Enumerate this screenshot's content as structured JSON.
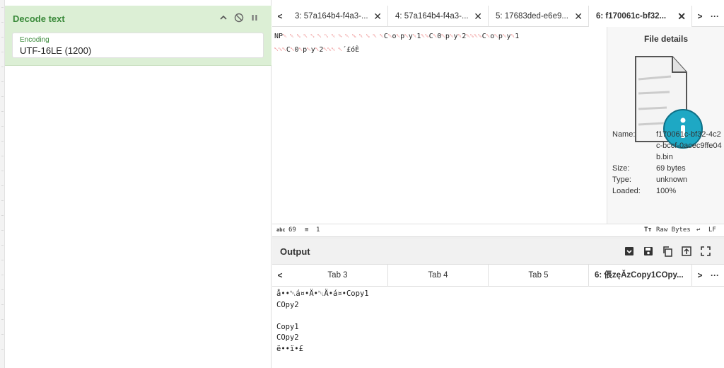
{
  "recipe": {
    "operation_title": "Decode text",
    "encoding_label": "Encoding",
    "encoding_value": "UTF-16LE (1200)"
  },
  "input": {
    "tabs": [
      {
        "label": "3: 57a164b4-f4a3-..."
      },
      {
        "label": "4: 57a164b4-f4a3-..."
      },
      {
        "label": "5: 17683ded-e6e9..."
      },
      {
        "label": "6: f170061c-bf32..."
      }
    ],
    "prev": "<",
    "next": ">",
    "more": "···",
    "line1_start": "NP",
    "line1_tail": "",
    "line2_end": "´£óÈ"
  },
  "file_details": {
    "title": "File details",
    "name_label": "Name:",
    "name_value": "f170061c-bf32-4c2c-bccf-0acec9ffe04b.bin",
    "size_label": "Size:",
    "size_value": "69 bytes",
    "type_label": "Type:",
    "type_value": "unknown",
    "loaded_label": "Loaded:",
    "loaded_value": "100%"
  },
  "status": {
    "chars_label": "abc",
    "chars": "69",
    "lines": "1",
    "raw_bytes": "Raw Bytes",
    "eol": "LF"
  },
  "output": {
    "title": "Output",
    "tabs": [
      {
        "label": "Tab 3"
      },
      {
        "label": "Tab 4"
      },
      {
        "label": "Tab 5"
      },
      {
        "label": "6: 倀zęĂzCopy1COpy..."
      }
    ],
    "prev": "<",
    "next": ">",
    "more": "···",
    "lines": [
      "COpy2",
      "",
      "Copy1",
      "COpy2"
    ],
    "line1": "å••␀á¤•Ä•␀Ä•á¤•Copy1",
    "last": "ë••ï•£"
  },
  "colors": {
    "op_bg": "#dcefd5",
    "op_title": "#3a8a3a",
    "control_char": "#dd2222"
  }
}
